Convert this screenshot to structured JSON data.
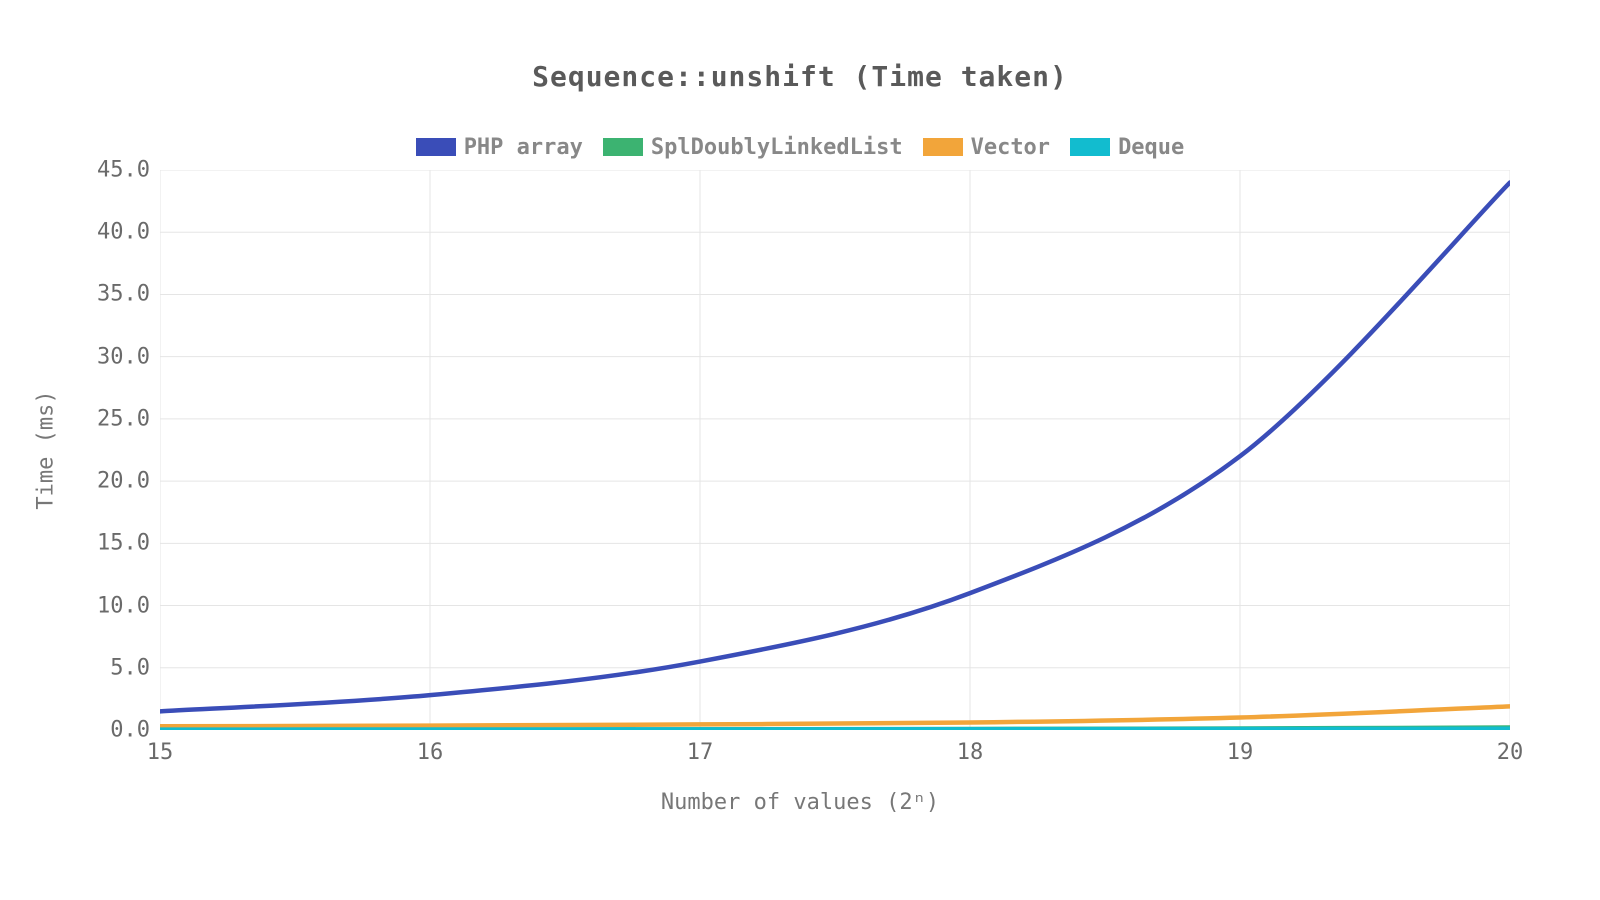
{
  "chart_data": {
    "type": "line",
    "title": "Sequence::unshift (Time taken)",
    "xlabel": "Number of values (2ⁿ)",
    "ylabel": "Time (ms)",
    "xlim": [
      15,
      20
    ],
    "ylim": [
      0,
      45
    ],
    "x_ticks": [
      15,
      16,
      17,
      18,
      19,
      20
    ],
    "y_ticks": [
      0.0,
      5.0,
      10.0,
      15.0,
      20.0,
      25.0,
      30.0,
      35.0,
      40.0,
      45.0
    ],
    "y_tick_labels": [
      "0.0",
      "5.0",
      "10.0",
      "15.0",
      "20.0",
      "25.0",
      "30.0",
      "35.0",
      "40.0",
      "45.0"
    ],
    "categories": [
      15,
      16,
      17,
      18,
      19,
      20
    ],
    "series": [
      {
        "name": "PHP array",
        "color": "#3a4db8",
        "values": [
          1.5,
          2.8,
          5.5,
          11.0,
          22.0,
          44.0
        ]
      },
      {
        "name": "SplDoublyLinkedList",
        "color": "#3cb371",
        "values": [
          0.02,
          0.03,
          0.05,
          0.08,
          0.12,
          0.2
        ]
      },
      {
        "name": "Vector",
        "color": "#f2a53a",
        "values": [
          0.3,
          0.35,
          0.45,
          0.6,
          1.0,
          1.9
        ]
      },
      {
        "name": "Deque",
        "color": "#12bccf",
        "values": [
          0.03,
          0.04,
          0.05,
          0.06,
          0.08,
          0.1
        ]
      }
    ],
    "legend_position": "top"
  }
}
